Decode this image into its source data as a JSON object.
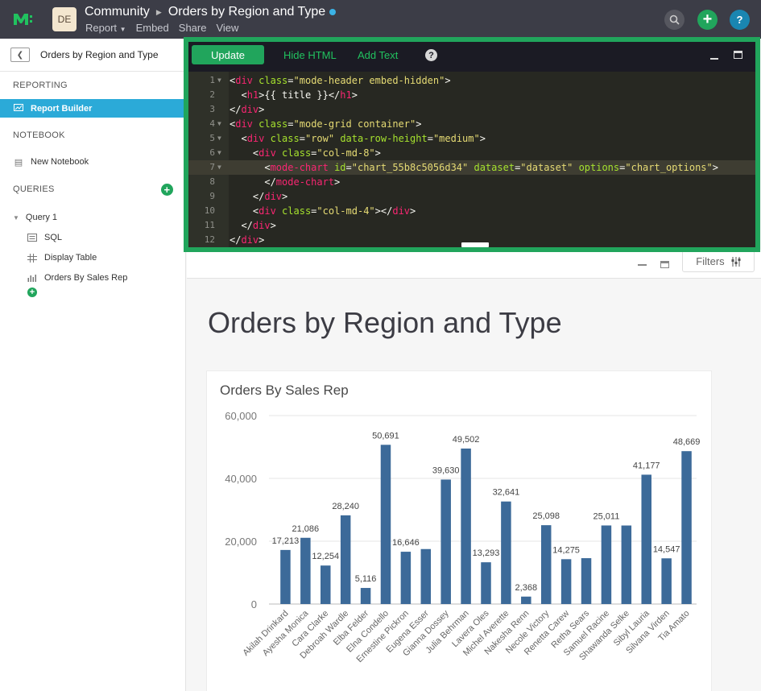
{
  "topbar": {
    "avatar_initials": "DE",
    "space_name": "Community",
    "report_title": "Orders by Region and Type",
    "menu": {
      "report": "Report",
      "embed": "Embed",
      "share": "Share",
      "view": "View"
    },
    "colors": {
      "bar": "#3c3d47",
      "add": "#21a55c",
      "help": "#1a86b1",
      "status_dot": "#3bb3e6"
    }
  },
  "sidebar": {
    "header_title": "Orders by Region and Type",
    "sections": {
      "reporting": "REPORTING",
      "notebook": "NOTEBOOK",
      "queries": "QUERIES"
    },
    "report_builder": "Report Builder",
    "new_notebook": "New Notebook",
    "query": {
      "name": "Query 1",
      "items": [
        {
          "label": "SQL",
          "icon": "sql-icon"
        },
        {
          "label": "Display Table",
          "icon": "table-icon"
        },
        {
          "label": "Orders By Sales Rep",
          "icon": "bar-chart-icon"
        }
      ]
    }
  },
  "editor": {
    "update_label": "Update",
    "hide_html_label": "Hide HTML",
    "add_text_label": "Add Text",
    "help_label": "?",
    "active_line": 7,
    "lines": [
      {
        "n": "1",
        "tokens": [
          [
            "p",
            "<"
          ],
          [
            "t",
            "div"
          ],
          [
            "p",
            " "
          ],
          [
            "a",
            "class"
          ],
          [
            "p",
            "="
          ],
          [
            "s",
            "\"mode-header embed-hidden\""
          ],
          [
            "p",
            ">"
          ]
        ]
      },
      {
        "n": "2",
        "tokens": [
          [
            "p",
            "  <"
          ],
          [
            "t",
            "h1"
          ],
          [
            "p",
            ">{{ title }}</"
          ],
          [
            "t",
            "h1"
          ],
          [
            "p",
            ">"
          ]
        ]
      },
      {
        "n": "3",
        "tokens": [
          [
            "p",
            "</"
          ],
          [
            "t",
            "div"
          ],
          [
            "p",
            ">"
          ]
        ]
      },
      {
        "n": "4",
        "tokens": [
          [
            "p",
            "<"
          ],
          [
            "t",
            "div"
          ],
          [
            "p",
            " "
          ],
          [
            "a",
            "class"
          ],
          [
            "p",
            "="
          ],
          [
            "s",
            "\"mode-grid container\""
          ],
          [
            "p",
            ">"
          ]
        ]
      },
      {
        "n": "5",
        "tokens": [
          [
            "p",
            "  <"
          ],
          [
            "t",
            "div"
          ],
          [
            "p",
            " "
          ],
          [
            "a",
            "class"
          ],
          [
            "p",
            "="
          ],
          [
            "s",
            "\"row\""
          ],
          [
            "p",
            " "
          ],
          [
            "a",
            "data-row-height"
          ],
          [
            "p",
            "="
          ],
          [
            "s",
            "\"medium\""
          ],
          [
            "p",
            ">"
          ]
        ]
      },
      {
        "n": "6",
        "tokens": [
          [
            "p",
            "    <"
          ],
          [
            "t",
            "div"
          ],
          [
            "p",
            " "
          ],
          [
            "a",
            "class"
          ],
          [
            "p",
            "="
          ],
          [
            "s",
            "\"col-md-8\""
          ],
          [
            "p",
            ">"
          ]
        ]
      },
      {
        "n": "7",
        "tokens": [
          [
            "p",
            "      <"
          ],
          [
            "t",
            "mode-chart"
          ],
          [
            "p",
            " "
          ],
          [
            "a",
            "id"
          ],
          [
            "p",
            "="
          ],
          [
            "s",
            "\"chart_55b8c5056d34\""
          ],
          [
            "p",
            " "
          ],
          [
            "a",
            "dataset"
          ],
          [
            "p",
            "="
          ],
          [
            "s",
            "\"dataset\""
          ],
          [
            "p",
            " "
          ],
          [
            "a",
            "options"
          ],
          [
            "p",
            "="
          ],
          [
            "s",
            "\"chart_options\""
          ],
          [
            "p",
            ">"
          ]
        ]
      },
      {
        "n": "8",
        "tokens": [
          [
            "p",
            "      </"
          ],
          [
            "t",
            "mode-chart"
          ],
          [
            "p",
            ">"
          ]
        ]
      },
      {
        "n": "9",
        "tokens": [
          [
            "p",
            "    </"
          ],
          [
            "t",
            "div"
          ],
          [
            "p",
            ">"
          ]
        ]
      },
      {
        "n": "10",
        "tokens": [
          [
            "p",
            "    <"
          ],
          [
            "t",
            "div"
          ],
          [
            "p",
            " "
          ],
          [
            "a",
            "class"
          ],
          [
            "p",
            "="
          ],
          [
            "s",
            "\"col-md-4\""
          ],
          [
            "p",
            "></"
          ],
          [
            "t",
            "div"
          ],
          [
            "p",
            ">"
          ]
        ]
      },
      {
        "n": "11",
        "tokens": [
          [
            "p",
            "  </"
          ],
          [
            "t",
            "div"
          ],
          [
            "p",
            ">"
          ]
        ]
      },
      {
        "n": "12",
        "tokens": [
          [
            "p",
            "</"
          ],
          [
            "t",
            "div"
          ],
          [
            "p",
            ">"
          ]
        ]
      }
    ]
  },
  "main": {
    "filters_label": "Filters",
    "report_heading": "Orders by Region and Type"
  },
  "chart_data": {
    "type": "bar",
    "title": "Orders By Sales Rep",
    "xlabel": "",
    "ylabel": "",
    "ylim": [
      0,
      60000
    ],
    "yticks": [
      "0",
      "20,000",
      "40,000",
      "60,000"
    ],
    "grid": true,
    "bar_color": "#3c6a99",
    "categories": [
      "Akilah Drinkard",
      "Ayesha Monica",
      "Cara Clarke",
      "Debroah Wardle",
      "Elba Felder",
      "Elna Condello",
      "Ernestine Pickron",
      "Eugena Esser",
      "Gianna Dossey",
      "Julia Behrman",
      "Lavera Oles",
      "Michel Averette",
      "Nakesha Renn",
      "Necole Victory",
      "Renetta Carew",
      "Retha Sears",
      "Samuel Racine",
      "Shawanda Selke",
      "Sibyl Lauria",
      "Silvana Virden",
      "Tia Amato"
    ],
    "values": [
      17213,
      21086,
      12254,
      28240,
      5116,
      50691,
      16646,
      17500,
      39630,
      49502,
      13293,
      32641,
      2368,
      25098,
      14275,
      14600,
      25011,
      25000,
      41177,
      14547,
      48669
    ],
    "labels": [
      "17,213",
      "21,086",
      "12,254",
      "28,240",
      "5,116",
      "50,691",
      "16,646",
      "",
      "39,630",
      "49,502",
      "13,293",
      "32,641",
      "2,368",
      "25,098",
      "14,275",
      "",
      "25,011",
      "",
      "41,177",
      "14,547",
      "48,669"
    ]
  }
}
